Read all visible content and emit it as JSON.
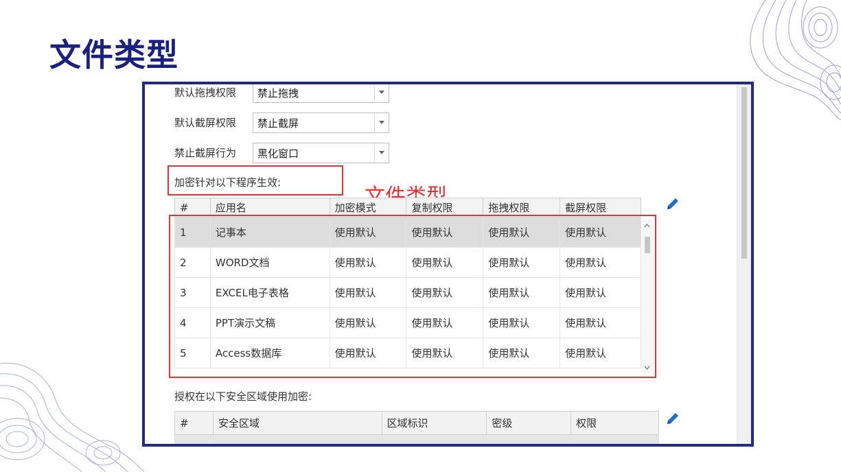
{
  "slide": {
    "title": "文件类型",
    "annotation": "文件类型"
  },
  "colors": {
    "title": "#1a2080",
    "frame": "#1f2a8a",
    "annotation": "#e53333"
  },
  "form": {
    "rows": [
      {
        "label": "默认拖拽权限",
        "value": "禁止拖拽"
      },
      {
        "label": "默认截屏权限",
        "value": "禁止截屏"
      },
      {
        "label": "禁止截屏行为",
        "value": "黑化窗口"
      }
    ]
  },
  "programs": {
    "label": "加密针对以下程序生效:",
    "columns": [
      "#",
      "应用名",
      "加密模式",
      "复制权限",
      "拖拽权限",
      "截屏权限"
    ],
    "rows": [
      [
        "1",
        "记事本",
        "使用默认",
        "使用默认",
        "使用默认",
        "使用默认"
      ],
      [
        "2",
        "WORD文档",
        "使用默认",
        "使用默认",
        "使用默认",
        "使用默认"
      ],
      [
        "3",
        "EXCEL电子表格",
        "使用默认",
        "使用默认",
        "使用默认",
        "使用默认"
      ],
      [
        "4",
        "PPT演示文稿",
        "使用默认",
        "使用默认",
        "使用默认",
        "使用默认"
      ],
      [
        "5",
        "Access数据库",
        "使用默认",
        "使用默认",
        "使用默认",
        "使用默认"
      ]
    ]
  },
  "zones": {
    "label": "授权在以下安全区域使用加密:",
    "columns": [
      "#",
      "安全区域",
      "区域标识",
      "密级",
      "权限"
    ]
  },
  "icons": {
    "edit": "pencil-icon",
    "combo": "chevron-down-icon"
  }
}
